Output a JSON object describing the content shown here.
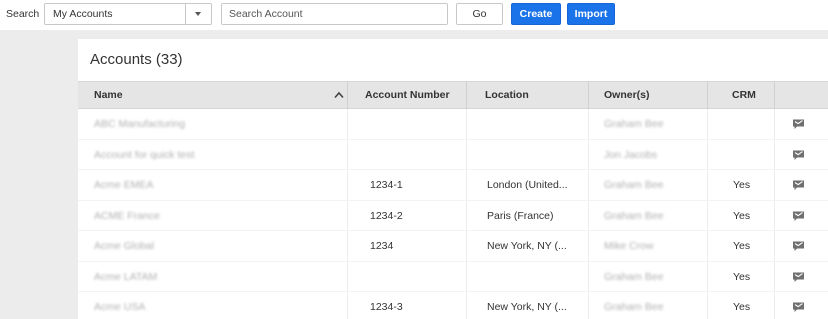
{
  "toolbar": {
    "search_label": "Search",
    "account_filter": {
      "selected": "My Accounts"
    },
    "search_placeholder": "Search Account",
    "go_label": "Go",
    "create_label": "Create",
    "import_label": "Import",
    "accent_color": "#1a73e8"
  },
  "accounts": {
    "title": "Accounts (33)",
    "columns": {
      "name": "Name",
      "account_number": "Account Number",
      "location": "Location",
      "owners": "Owner(s)",
      "crm": "CRM"
    },
    "sort": {
      "column": "Name",
      "direction": "ascending",
      "icon": "chevron-up-icon"
    },
    "row_action_icon": "message-icon",
    "rows": [
      {
        "name": "ABC Manufacturing",
        "account_number": "",
        "location": "",
        "owners": "Graham Bee",
        "crm": ""
      },
      {
        "name": "Account for quick test",
        "account_number": "",
        "location": "",
        "owners": "Jon Jacobs",
        "crm": ""
      },
      {
        "name": "Acme EMEA",
        "account_number": "1234-1",
        "location": "London (United...",
        "owners": "Graham Bee",
        "crm": "Yes"
      },
      {
        "name": "ACME France",
        "account_number": "1234-2",
        "location": "Paris (France)",
        "owners": "Graham Bee",
        "crm": "Yes"
      },
      {
        "name": "Acme Global",
        "account_number": "1234",
        "location": "New York, NY (...",
        "owners": "Mike Crow",
        "crm": "Yes"
      },
      {
        "name": "Acme LATAM",
        "account_number": "",
        "location": "",
        "owners": "Graham Bee",
        "crm": "Yes"
      },
      {
        "name": "Acme USA",
        "account_number": "1234-3",
        "location": "New York, NY (...",
        "owners": "Graham Bee",
        "crm": "Yes"
      }
    ]
  }
}
